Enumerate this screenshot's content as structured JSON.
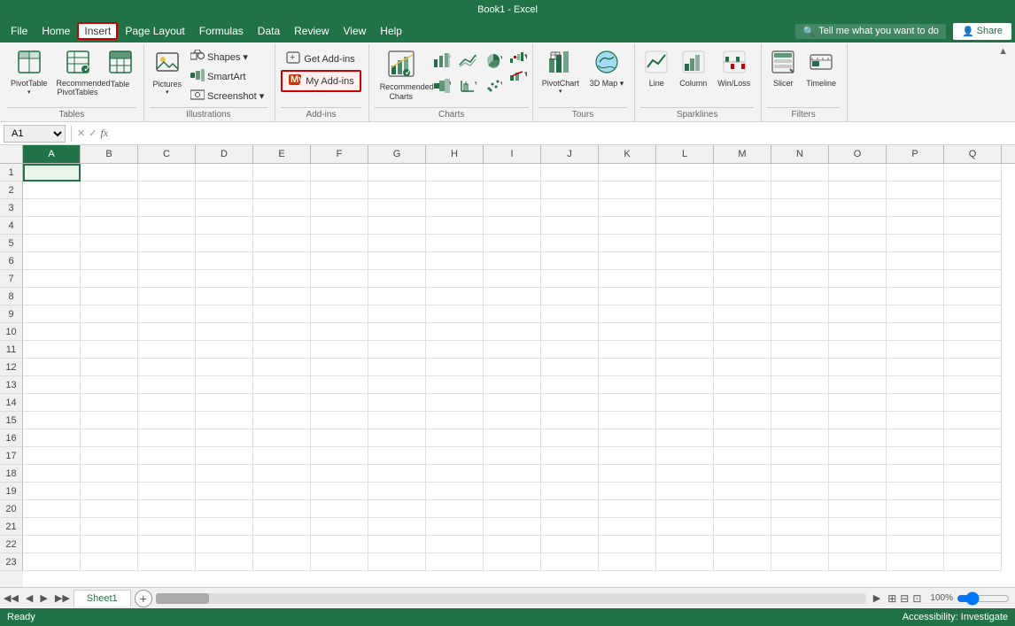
{
  "titlebar": {
    "text": "Book1 - Excel"
  },
  "menubar": {
    "items": [
      "File",
      "Home",
      "Insert",
      "Page Layout",
      "Formulas",
      "Data",
      "Review",
      "View",
      "Help"
    ],
    "active": "Insert",
    "search_placeholder": "Tell me what you want to do",
    "share_label": "Share"
  },
  "ribbon": {
    "groups": [
      {
        "name": "Tables",
        "items": [
          {
            "id": "pivot-table",
            "label": "PivotTable",
            "icon": "pivottable"
          },
          {
            "id": "recommended-pivottables",
            "label": "Recommended PivotTables",
            "icon": "rec-pivot"
          },
          {
            "id": "table",
            "label": "Table",
            "icon": "table"
          }
        ]
      },
      {
        "name": "Illustrations",
        "items": [
          {
            "id": "pictures",
            "label": "Pictures",
            "icon": "pictures"
          },
          {
            "id": "shapes",
            "label": "Shapes ▾",
            "icon": "shapes"
          },
          {
            "id": "smartart",
            "label": "SmartArt",
            "icon": "smartart"
          },
          {
            "id": "screenshot",
            "label": "Screenshot ▾",
            "icon": "screenshot"
          }
        ]
      },
      {
        "name": "Add-ins",
        "items": [
          {
            "id": "get-addins",
            "label": "Get Add-ins",
            "icon": "store"
          },
          {
            "id": "my-addins",
            "label": "My Add-ins",
            "icon": "myadd",
            "highlighted": true
          }
        ]
      },
      {
        "name": "Charts",
        "items": [
          {
            "id": "recommended-charts",
            "label": "Recommended Charts",
            "icon": "rec-charts"
          },
          {
            "id": "column-bar",
            "label": "",
            "icon": "col-bar"
          },
          {
            "id": "line-area",
            "label": "",
            "icon": "line-area"
          },
          {
            "id": "pie-donut",
            "label": "",
            "icon": "pie-donut"
          },
          {
            "id": "hierarchy",
            "label": "",
            "icon": "hierarchy"
          },
          {
            "id": "stat",
            "label": "",
            "icon": "stat"
          },
          {
            "id": "scatter",
            "label": "",
            "icon": "scatter"
          },
          {
            "id": "waterfall",
            "label": "",
            "icon": "waterfall"
          },
          {
            "id": "combo",
            "label": "",
            "icon": "combo"
          },
          {
            "id": "more-charts",
            "label": "",
            "icon": "more"
          }
        ]
      },
      {
        "name": "Tours",
        "items": [
          {
            "id": "pivot-chart",
            "label": "PivotChart",
            "icon": "pivotchart"
          },
          {
            "id": "3d-map",
            "label": "3D Map ▾",
            "icon": "3dmap"
          }
        ]
      },
      {
        "name": "Sparklines",
        "items": [
          {
            "id": "line-spark",
            "label": "Line",
            "icon": "line-spark"
          },
          {
            "id": "column-spark",
            "label": "Column",
            "icon": "col-spark"
          },
          {
            "id": "winloss",
            "label": "Win/Loss",
            "icon": "winloss"
          }
        ]
      },
      {
        "name": "Filters",
        "items": [
          {
            "id": "slicer",
            "label": "Slicer",
            "icon": "slicer"
          },
          {
            "id": "timeline",
            "label": "Timeline",
            "icon": "timeline"
          }
        ]
      }
    ]
  },
  "formulabar": {
    "cell_ref": "A1",
    "formula": ""
  },
  "spreadsheet": {
    "columns": [
      "A",
      "B",
      "C",
      "D",
      "E",
      "F",
      "G",
      "H",
      "I",
      "J",
      "K",
      "L",
      "M",
      "N",
      "O",
      "P",
      "Q"
    ],
    "rows": 23,
    "selected_cell": "A1"
  },
  "sheettabs": {
    "tabs": [
      "Sheet1"
    ],
    "active": "Sheet1"
  },
  "statusbar": {
    "ready": "Ready",
    "accessibility": "Accessibility: Investigate",
    "icons": [
      "page-break",
      "normal-view",
      "page-layout-view",
      "page-break-preview"
    ],
    "zoom": "100%"
  }
}
